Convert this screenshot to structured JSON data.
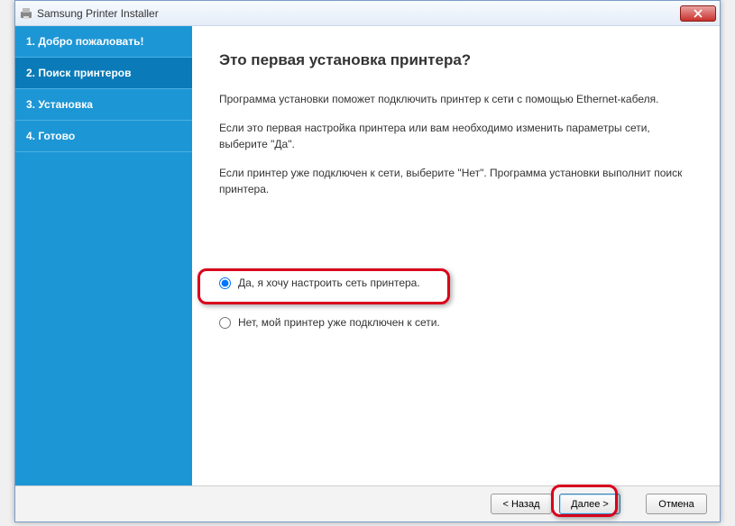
{
  "window": {
    "title": "Samsung Printer Installer"
  },
  "sidebar": {
    "steps": [
      {
        "label": "1. Добро пожаловать!"
      },
      {
        "label": "2. Поиск принтеров"
      },
      {
        "label": "3. Установка"
      },
      {
        "label": "4. Готово"
      }
    ]
  },
  "main": {
    "heading": "Это первая установка принтера?",
    "p1": "Программа установки поможет подключить принтер к сети с помощью Ethernet-кабеля.",
    "p2": "Если это первая настройка принтера или вам необходимо изменить параметры сети, выберите \"Да\".",
    "p3": "Если принтер уже подключен к сети, выберите \"Нет\". Программа установки выполнит поиск принтера.",
    "option_yes": "Да, я хочу настроить сеть принтера.",
    "option_no": "Нет, мой принтер уже подключен к сети."
  },
  "footer": {
    "back": "< Назад",
    "next": "Далее >",
    "cancel": "Отмена"
  }
}
